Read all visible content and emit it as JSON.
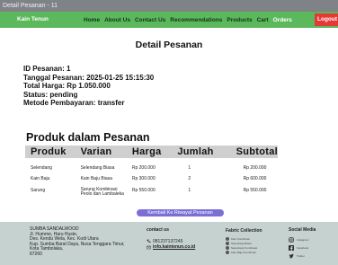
{
  "window": {
    "title": "Detail Pesanan - 11"
  },
  "navbar": {
    "brand": "Kain Tenun",
    "links": [
      "Home",
      "About Us",
      "Contact Us",
      "Recommendations",
      "Products",
      "Cart",
      "Orders"
    ],
    "logout": "Logout"
  },
  "page": {
    "title": "Detail Pesanan"
  },
  "order": {
    "id": "ID Pesanan: 1",
    "date": "Tanggal Pesanan: 2025-01-25 15:15:30",
    "total": "Total Harga: Rp 1.050.000",
    "status": "Status: pending",
    "payment": "Metode Pembayaran: transfer"
  },
  "products": {
    "title": "Produk dalam Pesanan",
    "headers": [
      "Produk",
      "Varian",
      "Harga",
      "Jumlah",
      "Subtotal"
    ],
    "rows": [
      [
        "Selendang",
        "Selendang Biasa",
        "Rp 200.000",
        "1",
        "Rp 200.000"
      ],
      [
        "Kain Baju",
        "Kain Baju Biasa",
        "Rp 300.000",
        "2",
        "Rp 600.000"
      ],
      [
        "Sarung",
        "Sarung Kombinasi Peolo dan Lambaleka",
        "Rp 550.000",
        "1",
        "Rp 550.000"
      ]
    ]
  },
  "back_button": "Kembali Ke Riwayat Pesanan",
  "footer": {
    "address": [
      "SUMBA SANDALWOOD",
      "Jl. Humme, Haru Huste,",
      "Des. Kendu Wela, Kec. Kodi Utara",
      "Kup. Sumba Barat Daya, Nusa Tenggara Timur,",
      "Kota Tambolaka,",
      "87260"
    ],
    "contact_title": "contact us",
    "phone": "081237137245",
    "email": "info.kaintenun.co.id",
    "fabric_title": "Fabric Collection",
    "fabric_items": [
      "Kain Kombinasi",
      "Selendang Biasa",
      "Selendang Kombinasi",
      "Kain Baju Kombinasi"
    ],
    "social_title": "Social Media",
    "social_items": [
      "Instagram",
      "Facebook",
      "Twitter"
    ]
  },
  "colors": {
    "navbar": "#5cb85c",
    "logout": "#e53935",
    "button": "#7b6fd6",
    "footer": "#c6d2d0"
  }
}
